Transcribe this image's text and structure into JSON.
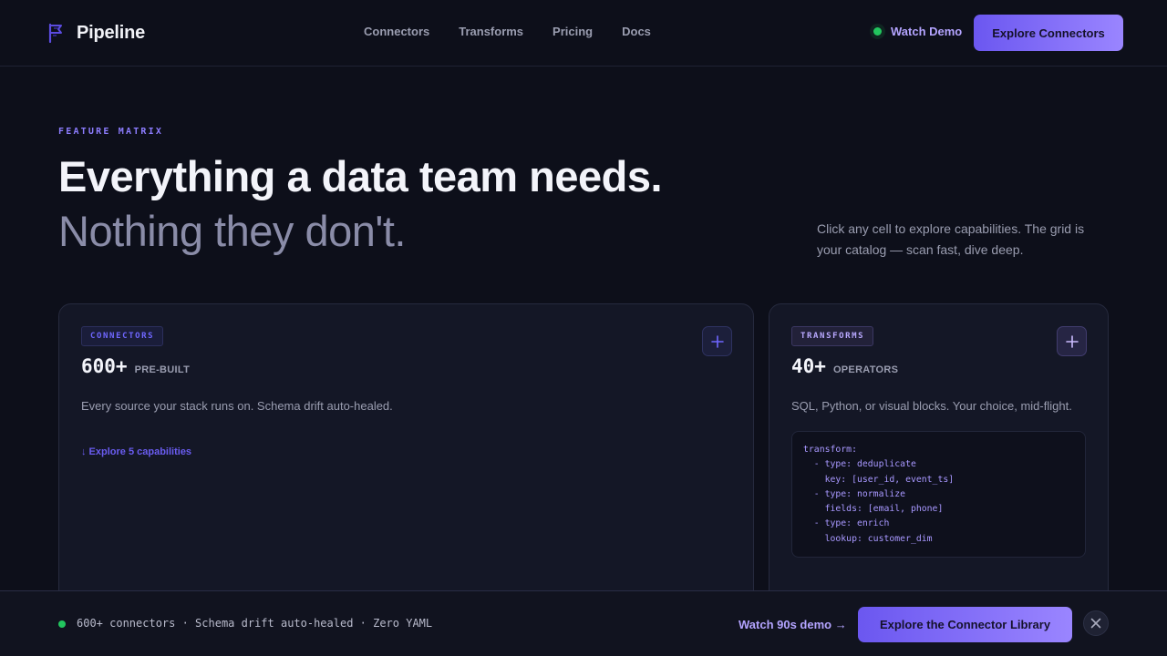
{
  "header": {
    "brand_name": "Pipeline",
    "brand_icon": "pipeline-flag-logo",
    "nav": [
      {
        "label": "Connectors"
      },
      {
        "label": "Transforms"
      },
      {
        "label": "Pricing"
      },
      {
        "label": "Docs"
      }
    ],
    "watch_demo_label": "Watch Demo",
    "cta_label": "Explore Connectors"
  },
  "hero": {
    "eyebrow": "FEATURE MATRIX",
    "headline_primary": "Everything a data team needs.",
    "headline_secondary": "Nothing they don't.",
    "note": "Click any cell to explore capabilities. The grid is your catalog — scan fast, dive deep."
  },
  "cards": {
    "connectors": {
      "tag": "CONNECTORS",
      "stat_value": "600+",
      "stat_unit": "PRE-BUILT",
      "description": "Every source your stack runs on. Schema drift auto-healed.",
      "explore_link": "↓ Explore 5 capabilities",
      "expand_icon": "plus-icon"
    },
    "transforms": {
      "tag": "TRANSFORMS",
      "stat_value": "40+",
      "stat_unit": "OPERATORS",
      "description": "SQL, Python, or visual blocks. Your choice, mid-flight.",
      "code": "transform:\n  - type: deduplicate\n    key: [user_id, event_ts]\n  - type: normalize\n    fields: [email, phone]\n  - type: enrich\n    lookup: customer_dim",
      "expand_icon": "plus-icon"
    }
  },
  "bottom_bar": {
    "status_text": "600+ connectors · Schema drift auto-healed · Zero YAML",
    "watch_link": "Watch 90s demo →",
    "cta_label": "Explore the Connector Library",
    "close_icon": "close-icon"
  },
  "colors": {
    "background": "#0d0f1a",
    "accent_start": "#6b57f0",
    "accent_end": "#9a85ff",
    "status_green": "#22c55e",
    "link_purple": "#b4a4ff"
  }
}
